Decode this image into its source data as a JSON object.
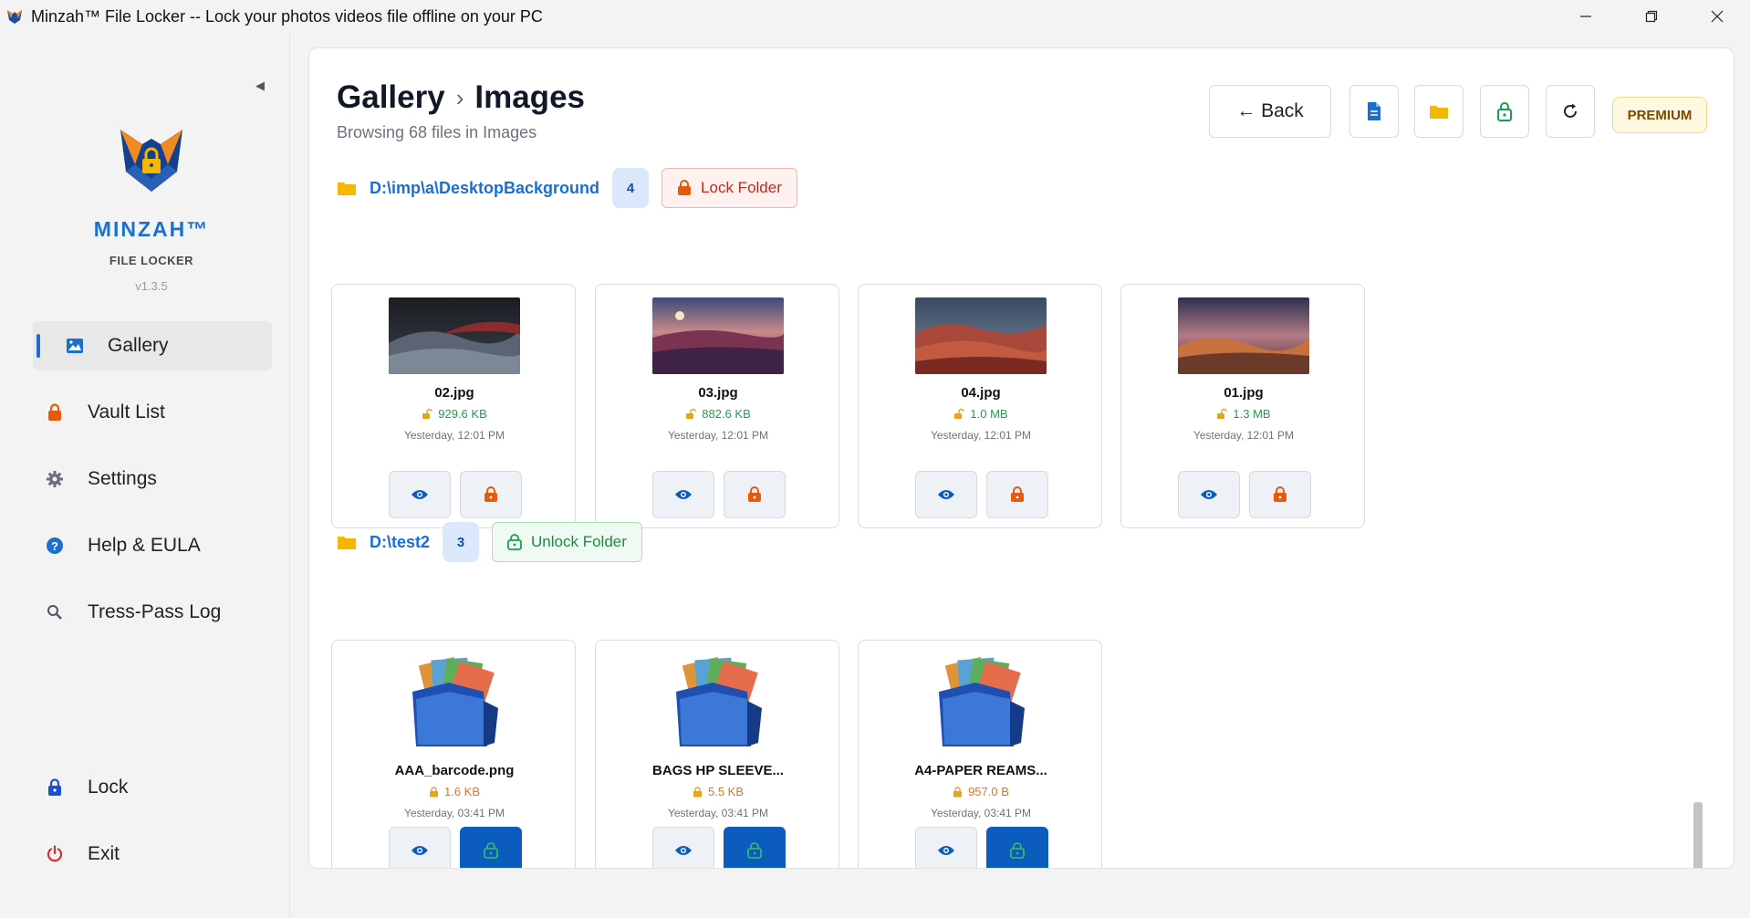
{
  "window": {
    "title": "Minzah™ File Locker -- Lock your photos videos file offline on your PC"
  },
  "sidebar": {
    "brand_name": "MINZAH™",
    "brand_sub": "FILE LOCKER",
    "version": "v1.3.5",
    "collapse_glyph": "◀",
    "items": [
      {
        "label": "Gallery",
        "icon": "image-icon",
        "active": true
      },
      {
        "label": "Vault List",
        "icon": "lock-icon"
      },
      {
        "label": "Settings",
        "icon": "gear-icon"
      },
      {
        "label": "Help & EULA",
        "icon": "help-icon"
      },
      {
        "label": "Tress-Pass Log",
        "icon": "search-icon"
      },
      {
        "label": "Lock",
        "icon": "lock-icon"
      },
      {
        "label": "Exit",
        "icon": "power-icon"
      }
    ]
  },
  "header": {
    "breadcrumb_root": "Gallery",
    "breadcrumb_sep": "›",
    "breadcrumb_current": "Images",
    "subtitle": "Browsing 68 files in Images",
    "back_label": "← Back",
    "premium_label": "PREMIUM"
  },
  "folders": [
    {
      "path": "D:\\imp\\a\\DesktopBackground",
      "count": "4",
      "action_label": "Lock Folder",
      "files": [
        {
          "name": "02.jpg",
          "size": "929.6 KB",
          "date": "Yesterday, 12:01 PM"
        },
        {
          "name": "03.jpg",
          "size": "882.6 KB",
          "date": "Yesterday, 12:01 PM"
        },
        {
          "name": "04.jpg",
          "size": "1.0 MB",
          "date": "Yesterday, 12:01 PM"
        },
        {
          "name": "01.jpg",
          "size": "1.3 MB",
          "date": "Yesterday, 12:01 PM"
        }
      ]
    },
    {
      "path": "D:\\test2",
      "count": "3",
      "action_label": "Unlock Folder",
      "files": [
        {
          "name": "AAA_barcode.png",
          "size": "1.6 KB",
          "date": "Yesterday, 03:41 PM"
        },
        {
          "name": "BAGS HP SLEEVE...",
          "size": "5.5 KB",
          "date": "Yesterday, 03:41 PM"
        },
        {
          "name": "A4-PAPER REAMS...",
          "size": "957.0 B",
          "date": "Yesterday, 03:41 PM"
        }
      ]
    }
  ],
  "colors": {
    "accent": "#1a6fd0",
    "lock_orange": "#e8590c",
    "unlock_green": "#1f9d4f",
    "folder_yellow": "#f5b800"
  }
}
